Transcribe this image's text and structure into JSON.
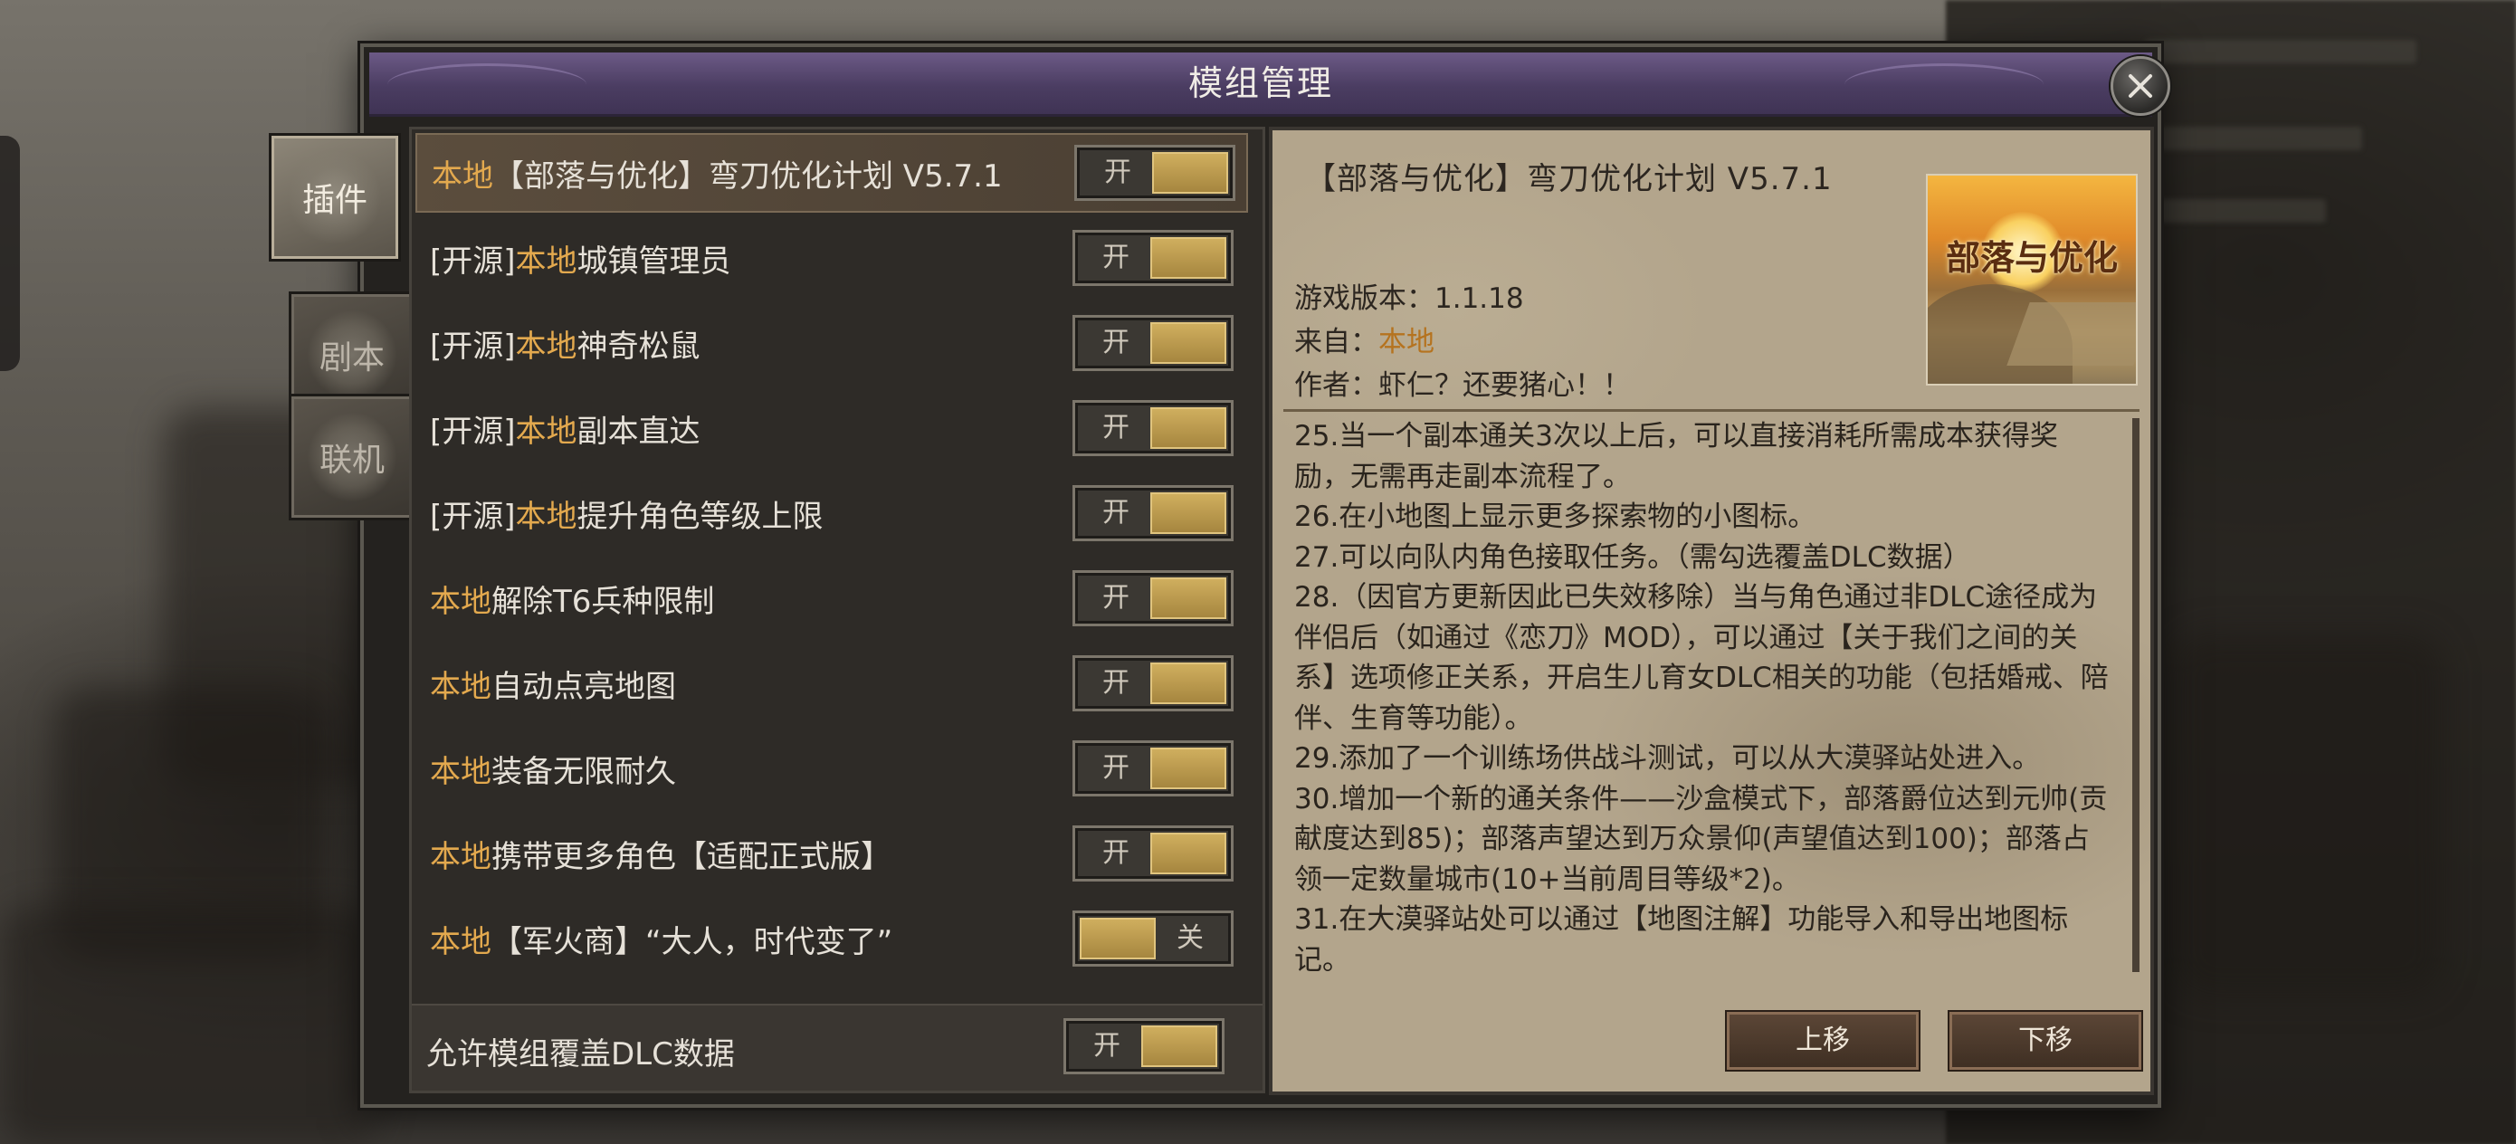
{
  "window": {
    "title": "模组管理"
  },
  "tabs": [
    {
      "label": "插件",
      "active": true
    },
    {
      "label": "剧本",
      "active": false
    },
    {
      "label": "联机",
      "active": false
    }
  ],
  "mods": [
    {
      "prefix": "",
      "tag": "本地",
      "name": "【部落与优化】弯刀优化计划 V5.7.1",
      "toggle": "开",
      "state": "on",
      "selected": true
    },
    {
      "prefix": "[开源]",
      "tag": "本地",
      "name": "城镇管理员",
      "toggle": "开",
      "state": "on"
    },
    {
      "prefix": "[开源]",
      "tag": "本地",
      "name": "神奇松鼠",
      "toggle": "开",
      "state": "on"
    },
    {
      "prefix": "[开源]",
      "tag": "本地",
      "name": "副本直达",
      "toggle": "开",
      "state": "on"
    },
    {
      "prefix": "[开源]",
      "tag": "本地",
      "name": "提升角色等级上限",
      "toggle": "开",
      "state": "on"
    },
    {
      "prefix": "",
      "tag": "本地",
      "name": "解除T6兵种限制",
      "toggle": "开",
      "state": "on"
    },
    {
      "prefix": "",
      "tag": "本地",
      "name": "自动点亮地图",
      "toggle": "开",
      "state": "on"
    },
    {
      "prefix": "",
      "tag": "本地",
      "name": "装备无限耐久",
      "toggle": "开",
      "state": "on"
    },
    {
      "prefix": "",
      "tag": "本地",
      "name": "携带更多角色【适配正式版】",
      "toggle": "开",
      "state": "on"
    },
    {
      "prefix": "",
      "tag": "本地",
      "name": "【军火商】“大人，时代变了”",
      "toggle": "关",
      "state": "off"
    }
  ],
  "footer": {
    "label": "允许模组覆盖DLC数据",
    "toggle": "开",
    "state": "on"
  },
  "detail": {
    "title": "【部落与优化】弯刀优化计划 V5.7.1",
    "image_text": "部落与优化",
    "game_version_label": "游戏版本：",
    "game_version": "1.1.18",
    "source_label": "来自：",
    "source": "本地",
    "author_label": "作者：",
    "author": "虾仁？还要猪心！！",
    "description": [
      "25.当一个副本通关3次以上后，可以直接消耗所需成本获得奖励，无需再走副本流程了。",
      "26.在小地图上显示更多探索物的小图标。",
      "27.可以向队内角色接取任务。（需勾选覆盖DLC数据）",
      "28.（因官方更新因此已失效移除）当与角色通过非DLC途径成为伴侣后（如通过《恋刀》MOD），可以通过【关于我们之间的关系】选项修正关系，开启生儿育女DLC相关的功能（包括婚戒、陪伴、生育等功能）。",
      "29.添加了一个训练场供战斗测试，可以从大漠驿站处进入。",
      "30.增加一个新的通关条件——沙盒模式下，部落爵位达到元帅(贡献度达到85)；部落声望达到万众景仰(声望值达到100)；部落占领一定数量城市(10+当前周目等级*2)。",
      "31.在大漠驿站处可以通过【地图注解】功能导入和导出地图标记。"
    ],
    "move_up": "上移",
    "move_down": "下移"
  },
  "colors": {
    "highlight": "#e3a94e",
    "toggle_knob": "#c4a253",
    "title_bar": "#5a4a72",
    "detail_bg": "#b3a58c"
  }
}
